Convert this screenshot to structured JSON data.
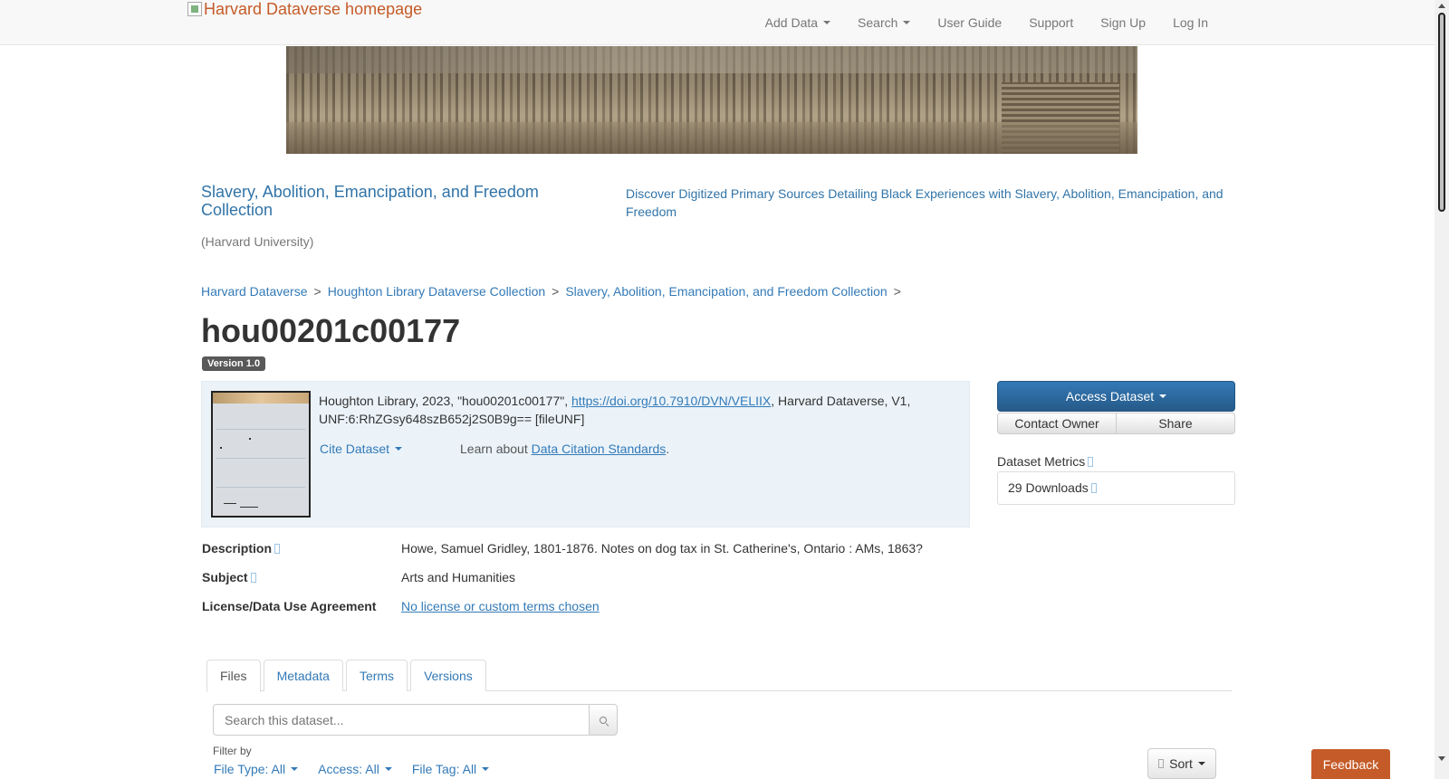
{
  "navbar": {
    "brand_alt": "Harvard Dataverse homepage",
    "items": [
      {
        "label": "Add Data",
        "dropdown": true
      },
      {
        "label": "Search",
        "dropdown": true
      },
      {
        "label": "User Guide",
        "dropdown": false
      },
      {
        "label": "Support",
        "dropdown": false
      },
      {
        "label": "Sign Up",
        "dropdown": false
      },
      {
        "label": "Log In",
        "dropdown": false
      }
    ]
  },
  "collection": {
    "title": "Slavery, Abolition, Emancipation, and Freedom Collection",
    "tagline": "Discover Digitized Primary Sources Detailing Black Experiences with Slavery, Abolition, Emancipation, and Freedom",
    "affiliation": "(Harvard University)"
  },
  "breadcrumb": [
    "Harvard Dataverse",
    "Houghton Library Dataverse Collection",
    "Slavery, Abolition, Emancipation, and Freedom Collection"
  ],
  "breadcrumb_sep": ">",
  "dataset": {
    "title": "hou00201c00177",
    "version": "Version 1.0",
    "citation_prefix": "Houghton Library, 2023, \"hou00201c00177\", ",
    "citation_link": "https://doi.org/10.7910/DVN/VELIIX",
    "citation_suffix": ", Harvard Dataverse, V1, UNF:6:RhZGsy648szB652j2S0B9g== [fileUNF]",
    "cite_label": "Cite Dataset",
    "learn_prefix": "Learn about ",
    "learn_link": "Data Citation Standards",
    "learn_suffix": "."
  },
  "actions": {
    "access": "Access Dataset",
    "contact": "Contact Owner",
    "share": "Share"
  },
  "metrics": {
    "heading": "Dataset Metrics",
    "downloads": "29 Downloads"
  },
  "metadata": {
    "description_label": "Description",
    "description_value": "Howe, Samuel Gridley, 1801-1876. Notes on dog tax in St. Catherine's, Ontario : AMs, 1863?",
    "subject_label": "Subject",
    "subject_value": "Arts and Humanities",
    "license_label": "License/Data Use Agreement",
    "license_value": "No license or custom terms chosen"
  },
  "tabs": [
    "Files",
    "Metadata",
    "Terms",
    "Versions"
  ],
  "files": {
    "search_placeholder": "Search this dataset...",
    "filter_label": "Filter by",
    "filters": [
      "File Type: All",
      "Access: All",
      "File Tag: All"
    ],
    "sort_label": "Sort"
  },
  "feedback": "Feedback",
  "colors": {
    "link": "#337ab7",
    "brand": "#c55b28",
    "primary": "#337ab7",
    "citation_bg": "#ebf3f9"
  }
}
